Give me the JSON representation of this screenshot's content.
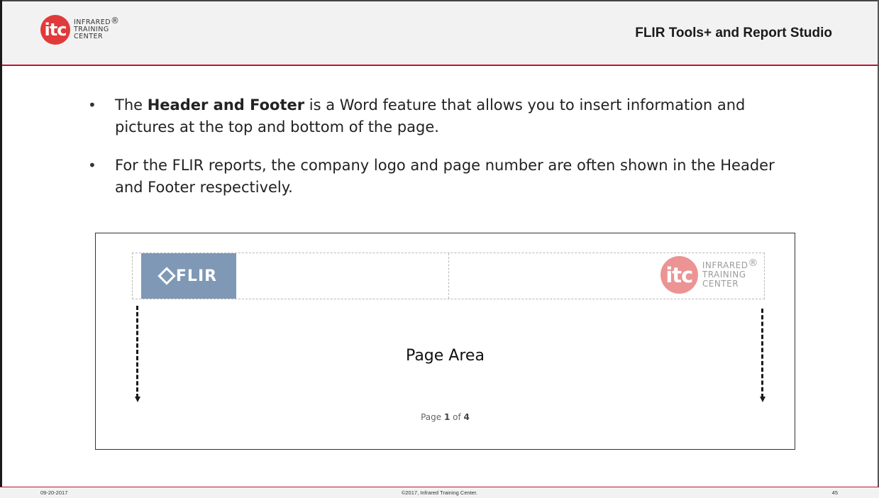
{
  "header": {
    "logo": {
      "mark": "itc",
      "lines": [
        "INFRARED",
        "TRAINING",
        "CENTER"
      ],
      "registered": "®"
    },
    "title": "FLIR Tools+ and Report Studio"
  },
  "bullets": [
    {
      "pre": "The ",
      "bold": "Header and Footer",
      "post": " is a Word feature that allows you to insert information and pictures at the top and bottom of the page."
    },
    {
      "pre": "For the FLIR reports, the company logo and page number are often shown in the Header and Footer respectively.",
      "bold": "",
      "post": ""
    }
  ],
  "illustration": {
    "flir_logo_text": "FLIR",
    "itc_logo": {
      "mark": "itc",
      "lines": [
        "INFRARED",
        "TRAINING",
        "CENTER"
      ],
      "registered": "®"
    },
    "page_area_label": "Page Area",
    "page_number": {
      "prefix": "Page ",
      "current": "1",
      "middle": " of ",
      "total": "4"
    }
  },
  "footer": {
    "date": "09-20-2017",
    "copyright": "©2017, Infrared Training Center.",
    "slide_number": "45"
  },
  "colors": {
    "accent": "#c8102e",
    "itc_red": "#e23a3a",
    "flir_blue": "#7e98b5"
  }
}
